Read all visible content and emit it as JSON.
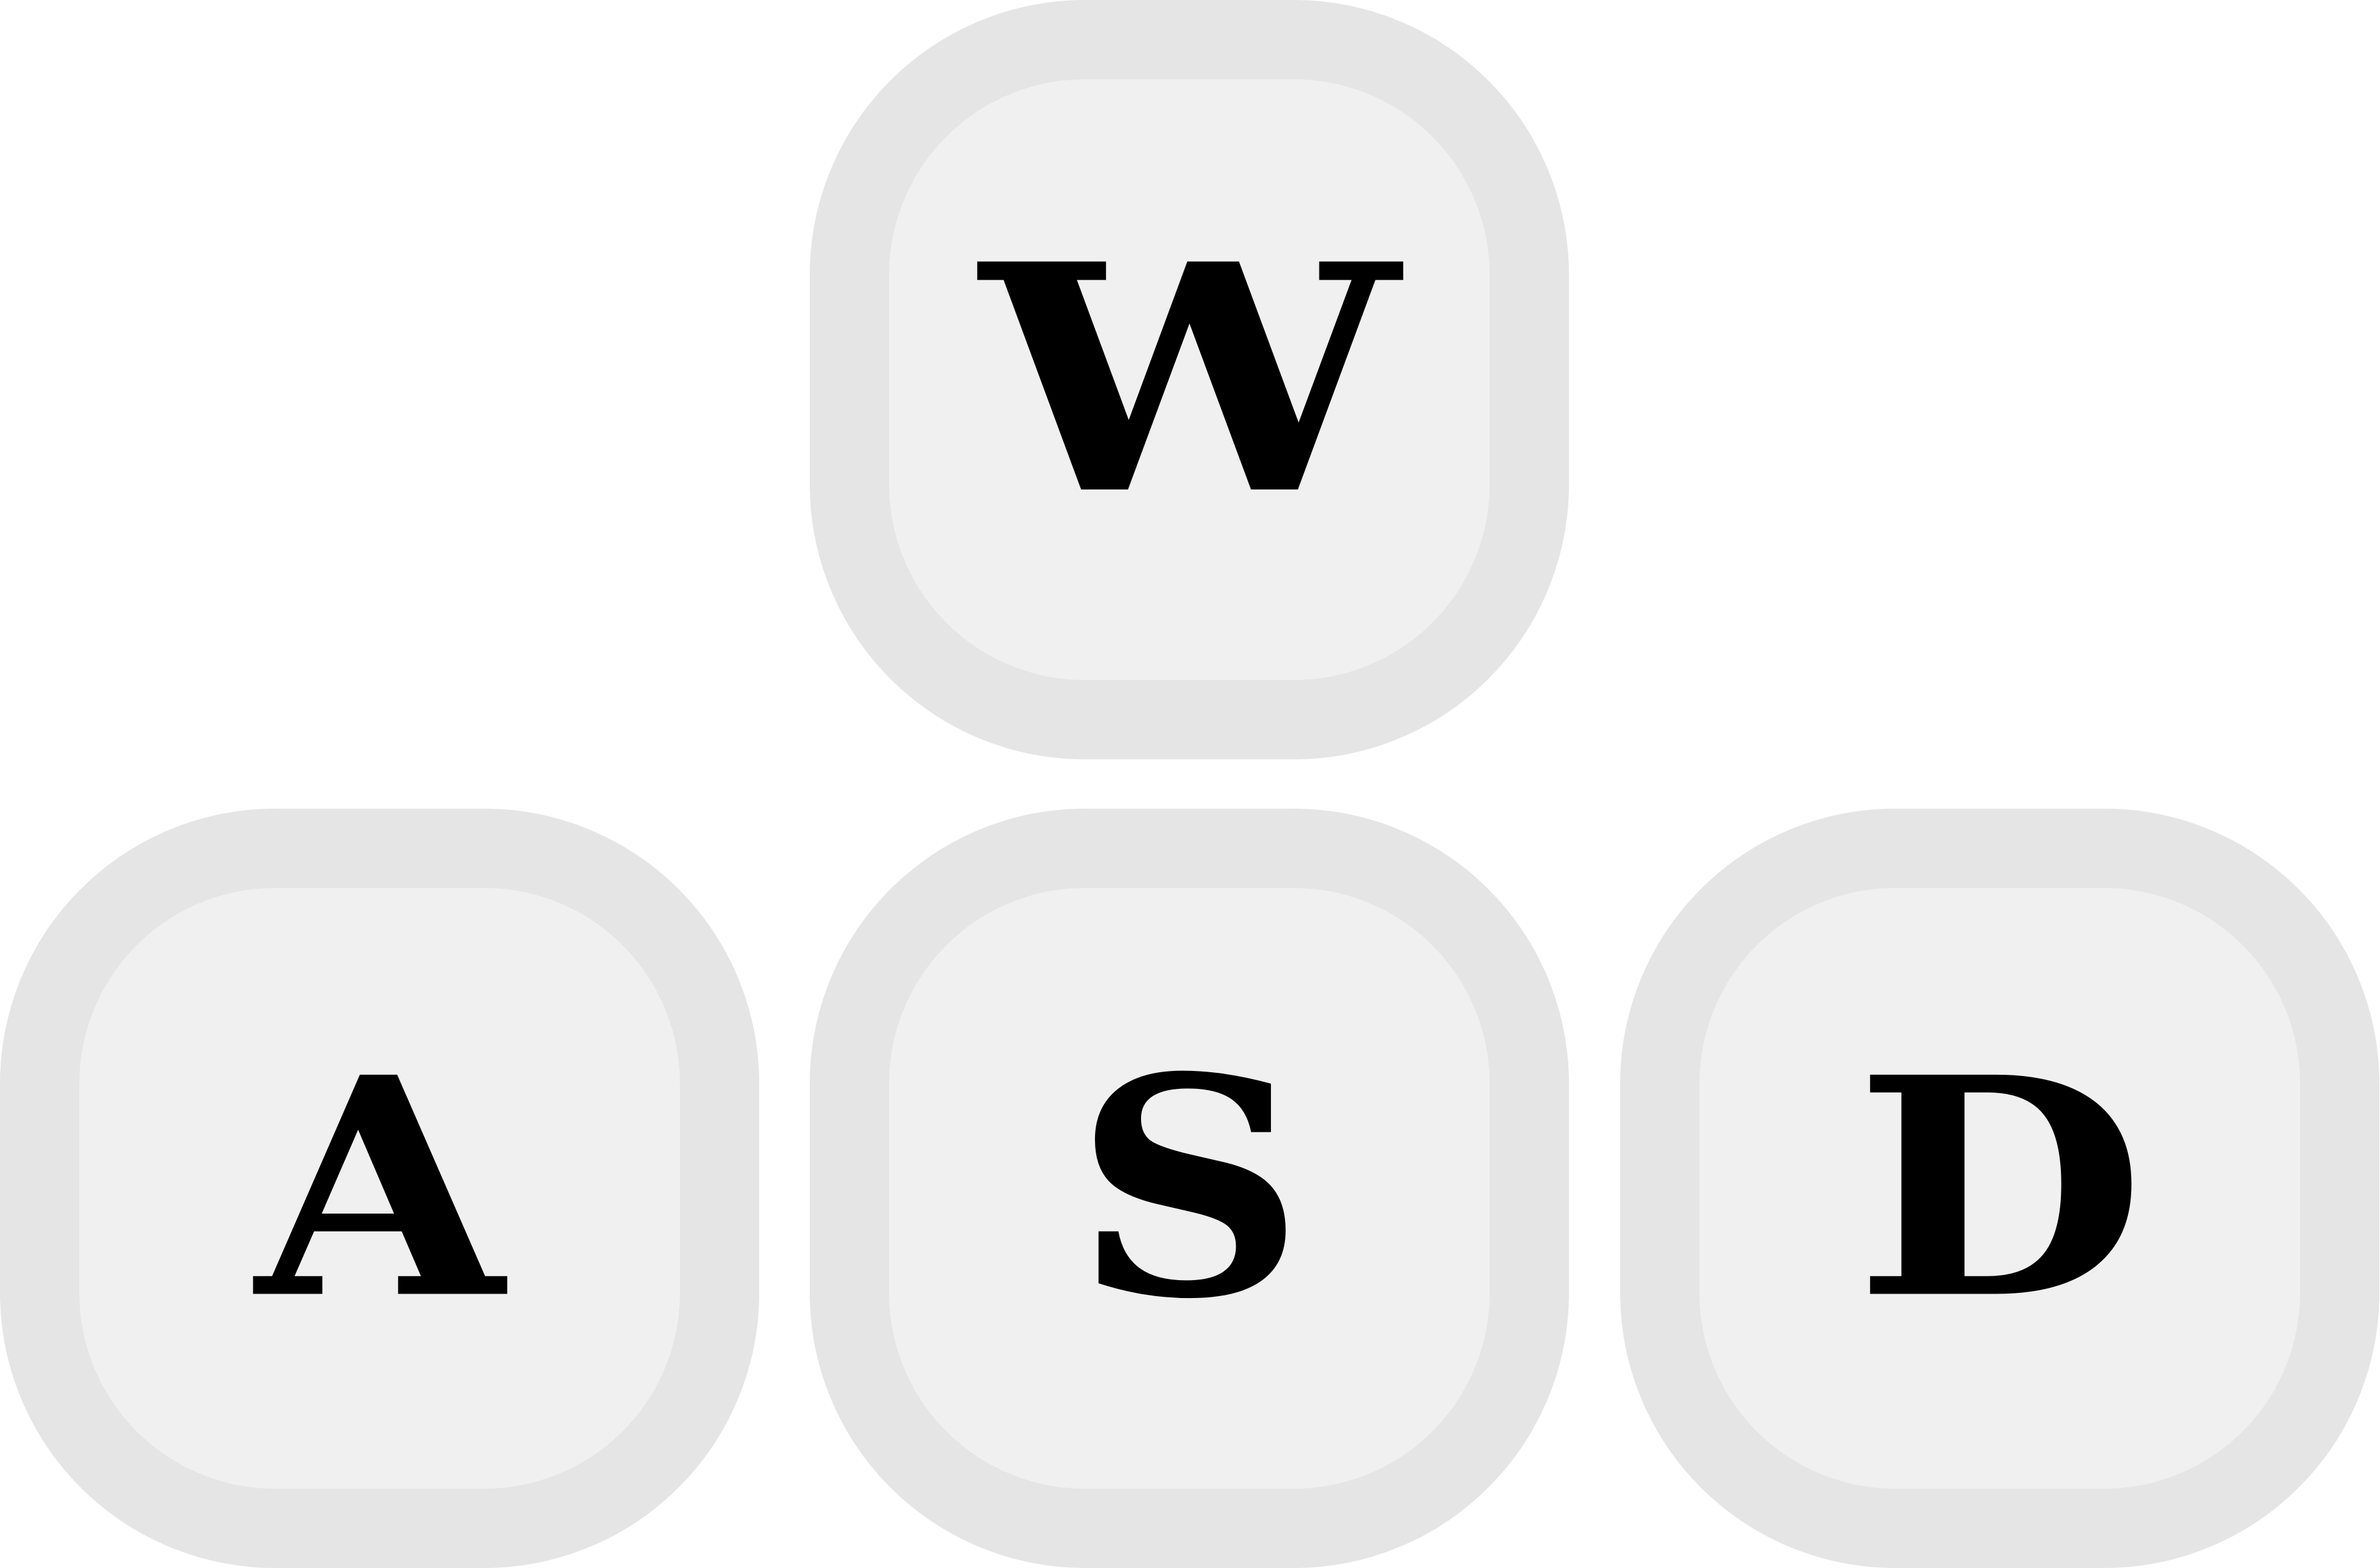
{
  "keys": {
    "w": {
      "label": "W"
    },
    "a": {
      "label": "A"
    },
    "s": {
      "label": "S"
    },
    "d": {
      "label": "D"
    }
  },
  "colors": {
    "key_border": "#e5e5e5",
    "key_face": "#f0f0f0",
    "letter": "#000000",
    "background": "#ffffff"
  }
}
